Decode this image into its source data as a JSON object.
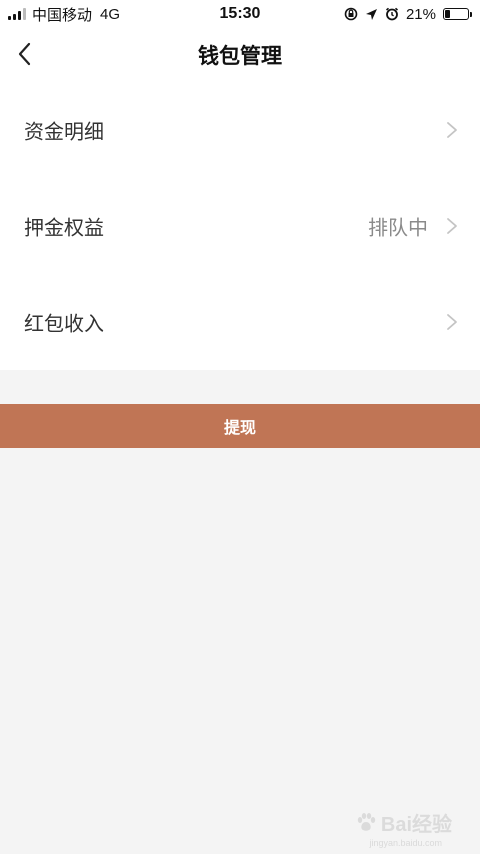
{
  "status_bar": {
    "carrier": "中国移动",
    "network": "4G",
    "time": "15:30",
    "battery_percent": "21%",
    "battery_level": 0.21
  },
  "nav": {
    "title": "钱包管理",
    "back_icon": "chevron-left-icon"
  },
  "menu": {
    "items": [
      {
        "label": "资金明细",
        "value": ""
      },
      {
        "label": "押金权益",
        "value": "排队中"
      },
      {
        "label": "红包收入",
        "value": ""
      }
    ]
  },
  "actions": {
    "withdraw_label": "提现",
    "withdraw_color": "#c07555"
  },
  "watermark": {
    "text": "Bai经验",
    "url": "jingyan.baidu.com"
  }
}
